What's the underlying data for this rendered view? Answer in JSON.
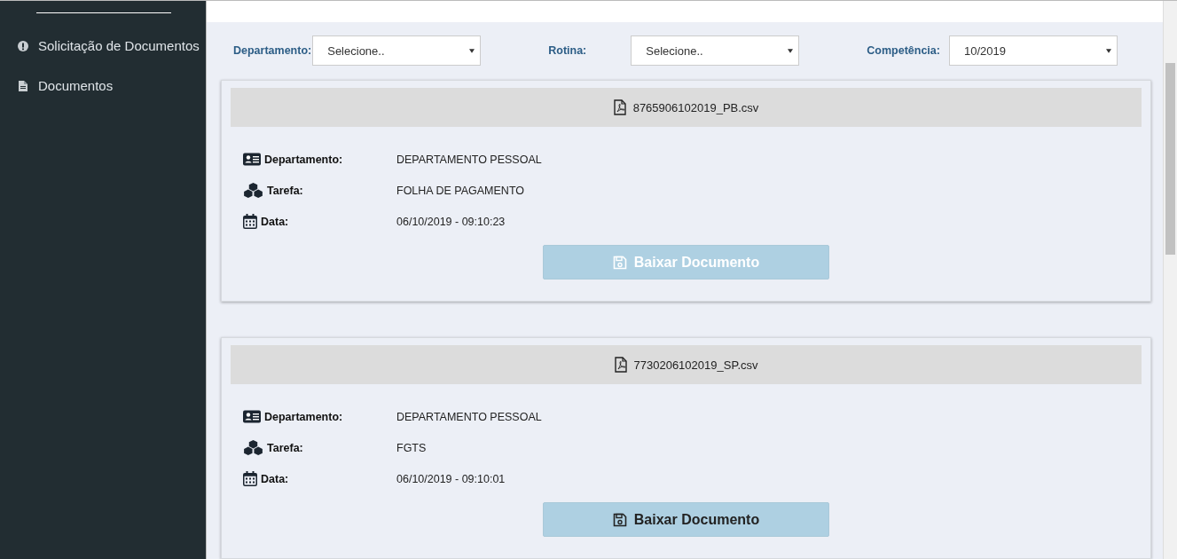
{
  "sidebar": {
    "items": [
      {
        "label": "Solicitação de Documentos",
        "kind": "alert"
      },
      {
        "label": "Documentos",
        "kind": "file"
      }
    ]
  },
  "filters": [
    {
      "label": "Departamento:",
      "value": "Selecione.."
    },
    {
      "label": "Rotina:",
      "value": "Selecione.."
    },
    {
      "label": "Competência:",
      "value": "10/2019"
    }
  ],
  "documents": [
    {
      "filename": "8765906102019_PB.csv",
      "fields": [
        {
          "kind": "department",
          "label": "Departamento:",
          "value": "DEPARTAMENTO PESSOAL"
        },
        {
          "kind": "task",
          "label": "Tarefa:",
          "value": "FOLHA DE PAGAMENTO"
        },
        {
          "kind": "date",
          "label": "Data:",
          "value": "06/10/2019 - 09:10:23"
        }
      ],
      "button": "Baixar Documento",
      "hovered": true
    },
    {
      "filename": "7730206102019_SP.csv",
      "fields": [
        {
          "kind": "department",
          "label": "Departamento:",
          "value": "DEPARTAMENTO PESSOAL"
        },
        {
          "kind": "task",
          "label": "Tarefa:",
          "value": "FGTS"
        },
        {
          "kind": "date",
          "label": "Data:",
          "value": "06/10/2019 - 09:10:01"
        }
      ],
      "button": "Baixar Documento",
      "hovered": false
    }
  ]
}
